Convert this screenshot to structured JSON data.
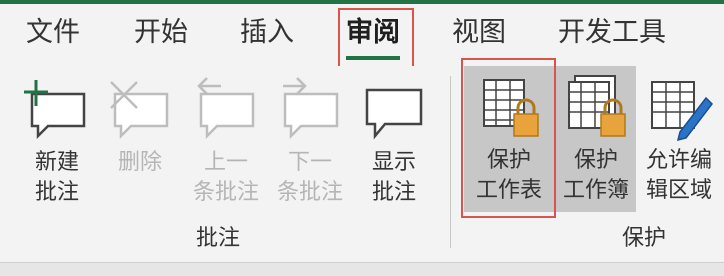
{
  "tabs": [
    {
      "label": "文件"
    },
    {
      "label": "开始"
    },
    {
      "label": "插入"
    },
    {
      "label": "审阅",
      "active": true
    },
    {
      "label": "视图"
    },
    {
      "label": "开发工具"
    }
  ],
  "groups": {
    "comments": {
      "label": "批注",
      "commands": {
        "new": "新建\n批注",
        "delete": "删除",
        "previous": "上一\n条批注",
        "next": "下一\n条批注",
        "show": "显示\n批注"
      }
    },
    "protect": {
      "label": "保护",
      "commands": {
        "protect_sheet": "保护\n工作表",
        "protect_workbook": "保护\n工作簿",
        "allow_edit_ranges": "允许编\n辑区域"
      }
    }
  },
  "colors": {
    "accent": "#217346",
    "highlight": "#d9534f",
    "lock": "#e8a33c",
    "pencil": "#2b73c6",
    "disabled": "#b5b5b5"
  },
  "icons": {
    "new": "new-comment-icon",
    "delete": "delete-comment-icon",
    "previous": "previous-comment-icon",
    "next": "next-comment-icon",
    "show": "show-comment-icon",
    "protect_sheet": "protect-sheet-icon",
    "protect_workbook": "protect-workbook-icon",
    "allow_edit_ranges": "allow-edit-ranges-icon"
  }
}
